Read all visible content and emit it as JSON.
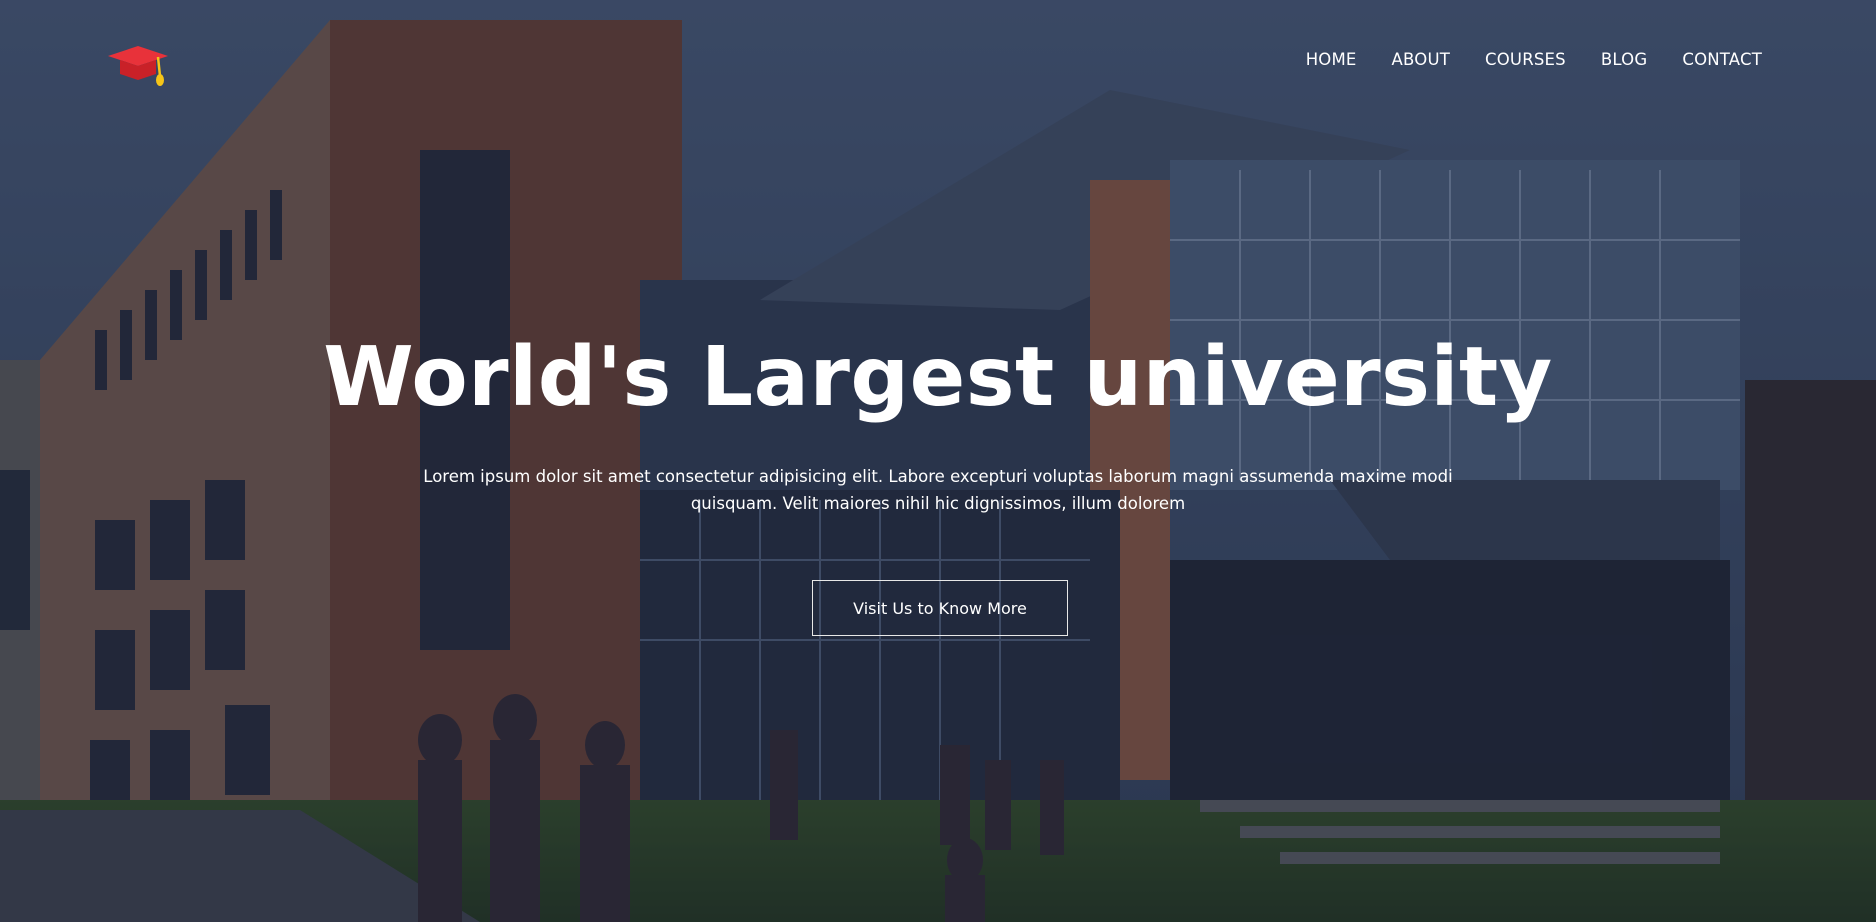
{
  "brand": {
    "logo_icon": "graduation-cap-icon"
  },
  "nav": {
    "items": [
      {
        "label": "HOME"
      },
      {
        "label": "ABOUT"
      },
      {
        "label": "COURSES"
      },
      {
        "label": "BLOG"
      },
      {
        "label": "CONTACT"
      }
    ]
  },
  "hero": {
    "title": "World's Largest university",
    "description_line1": "Lorem ipsum dolor sit amet consectetur adipisicing elit. Labore excepturi voluptas laborum magni assumenda maxime modi",
    "description_line2": "quisquam. Velit maiores nihil hic dignissimos, illum dolorem",
    "cta_label": "Visit Us to Know More",
    "background_image": "university-campus-photo"
  },
  "colors": {
    "overlay": "#121a30",
    "text": "#ffffff",
    "logo_red": "#e8323a",
    "logo_tassel": "#f5c518"
  }
}
